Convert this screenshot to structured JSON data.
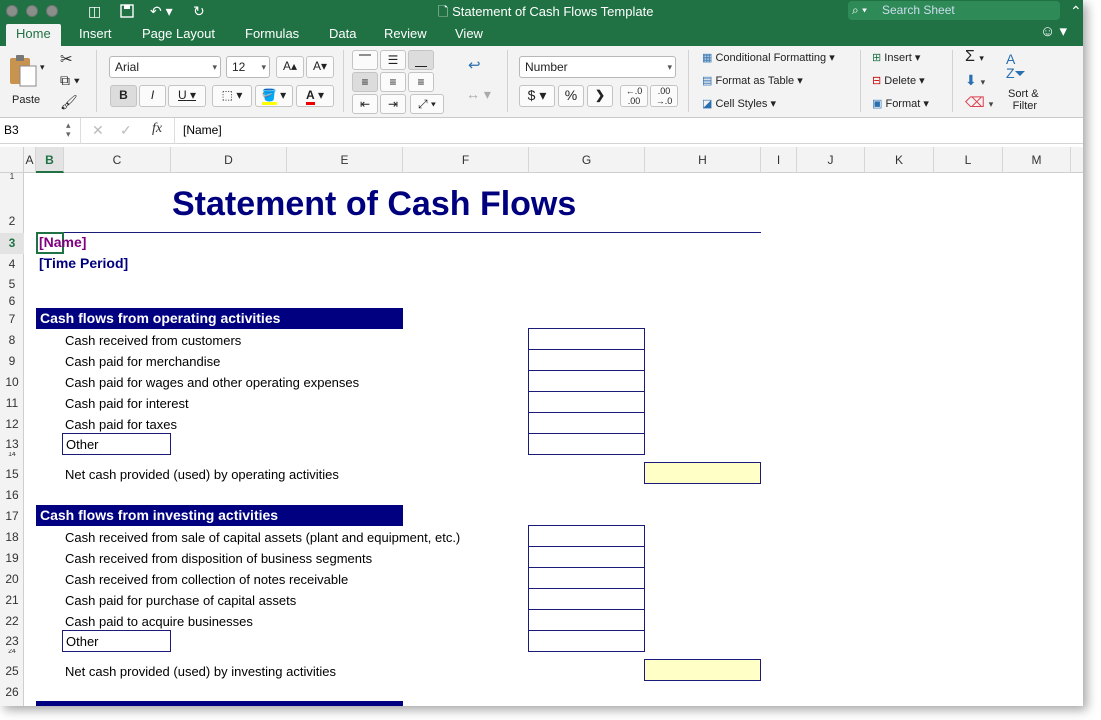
{
  "window": {
    "title": "Statement of Cash Flows Template",
    "search_placeholder": "Search Sheet"
  },
  "tabs": [
    "Home",
    "Insert",
    "Page Layout",
    "Formulas",
    "Data",
    "Review",
    "View"
  ],
  "active_tab": "Home",
  "ribbon": {
    "paste_label": "Paste",
    "font_name": "Arial",
    "font_size": "12",
    "number_format": "Number",
    "conditional_formatting": "Conditional Formatting",
    "format_as_table": "Format as Table",
    "cell_styles": "Cell Styles",
    "insert": "Insert",
    "delete": "Delete",
    "format": "Format",
    "sort_filter_line1": "Sort &",
    "sort_filter_line2": "Filter",
    "bold": "B",
    "italic": "I",
    "underline": "U",
    "currency": "$",
    "percent": "%",
    "comma": "❯",
    "increase_decimal": ".00",
    "decrease_decimal": ".00"
  },
  "formula_bar": {
    "name_box": "B3",
    "fx": "fx",
    "value": "[Name]"
  },
  "columns": [
    "A",
    "B",
    "C",
    "D",
    "E",
    "F",
    "G",
    "H",
    "I",
    "J",
    "K",
    "L",
    "M"
  ],
  "selected_column": "B",
  "rows": [
    "1",
    "2",
    "3",
    "4",
    "5",
    "6",
    "7",
    "8",
    "9",
    "10",
    "11",
    "12",
    "13",
    "14",
    "15",
    "16",
    "17",
    "18",
    "19",
    "20",
    "21",
    "22",
    "23",
    "24",
    "25",
    "26"
  ],
  "selected_row": "3",
  "sheet": {
    "title": "Statement of Cash Flows",
    "name": "[Name]",
    "period": "[Time Period]",
    "operating": {
      "header": "Cash flows from operating activities",
      "items": [
        "Cash received from customers",
        "Cash paid for merchandise",
        "Cash paid for wages and other operating expenses",
        "Cash paid for interest",
        "Cash paid for taxes"
      ],
      "other": "Other",
      "net": "Net cash provided (used) by operating activities"
    },
    "investing": {
      "header": "Cash flows from investing activities",
      "items": [
        "Cash received from sale of capital assets (plant and equipment, etc.)",
        "Cash received from disposition of business segments",
        "Cash received from collection of notes receivable",
        "Cash paid for purchase of capital assets",
        "Cash paid to acquire businesses"
      ],
      "other": "Other",
      "net": "Net cash provided (used) by investing activities"
    }
  },
  "colors": {
    "excel_green": "#207245",
    "header_navy": "#000080",
    "title_navy": "#00007f",
    "name_purple": "#800080",
    "net_yellow": "#ffffc6"
  }
}
